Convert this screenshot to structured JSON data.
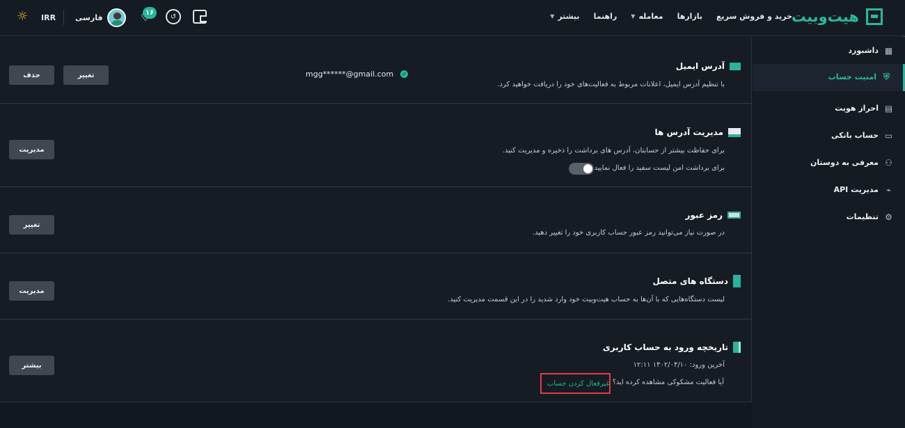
{
  "header": {
    "logo": "هیت‌وبیت",
    "nav": [
      "خرید و فروش سریع",
      "بازارها",
      "معامله",
      "راهنما",
      "بیشتر"
    ],
    "notification_count": "۱۶",
    "language": "فارسی",
    "currency": "IRR",
    "icons": [
      "wallet-icon",
      "history-icon",
      "bell-icon",
      "avatar",
      "sun-icon"
    ]
  },
  "sidebar": {
    "items": [
      "داشبورد",
      "امنیت حساب",
      "احراز هویت",
      "حساب بانکی",
      "معرفی به دوستان",
      "مدیریت API",
      "تنظیمات"
    ]
  },
  "sections": {
    "email": {
      "title": "آدرس ایمیل",
      "description": "با تنظیم آدرس ایمیل، اعلانات مربوط به فعالیت‌های خود را دریافت خواهید کرد.",
      "value": "mgg******@gmail.com",
      "buttons": [
        "حذف",
        "تغییر"
      ]
    },
    "addresses": {
      "title": "مدیریت آدرس ها",
      "description": "برای حفاظت بیشتر از حسابتان، آدرس های برداشت را ذخیره و مدیریت کنید.",
      "toggle_label": "برای برداشت امن لیست سفید را فعال نمایید.",
      "button": "مدیریت"
    },
    "password": {
      "title": "رمز عبور",
      "description": "در صورت نیاز می‌توانید رمز عبور حساب کاربری خود را تغییر دهید.",
      "button": "تغییر"
    },
    "devices": {
      "title": "دستگاه های متصل",
      "description": "لیست دستگاه‌هایی که با آن‌ها به حساب هیت‌وبیت خود وارد شدید را در این قسمت مدیریت کنید.",
      "button": "مدیریت"
    },
    "login_history": {
      "title": "تاریخچه ورود به حساب کاربری",
      "last_login_label": "آخرین ورود:",
      "last_login_value": "۱۴۰۲/۰۴/۱۰  ۱۲:۱۱",
      "suspicious_question": "آیا فعالیت مشکوکی مشاهده کرده اید؟",
      "deactivate_link": "غیرفعال کردن حساب",
      "button": "بیشتر"
    }
  },
  "colors": {
    "accent": "#2ab99d",
    "background": "#151c24",
    "button": "#404750",
    "highlight": "#e43d43"
  }
}
